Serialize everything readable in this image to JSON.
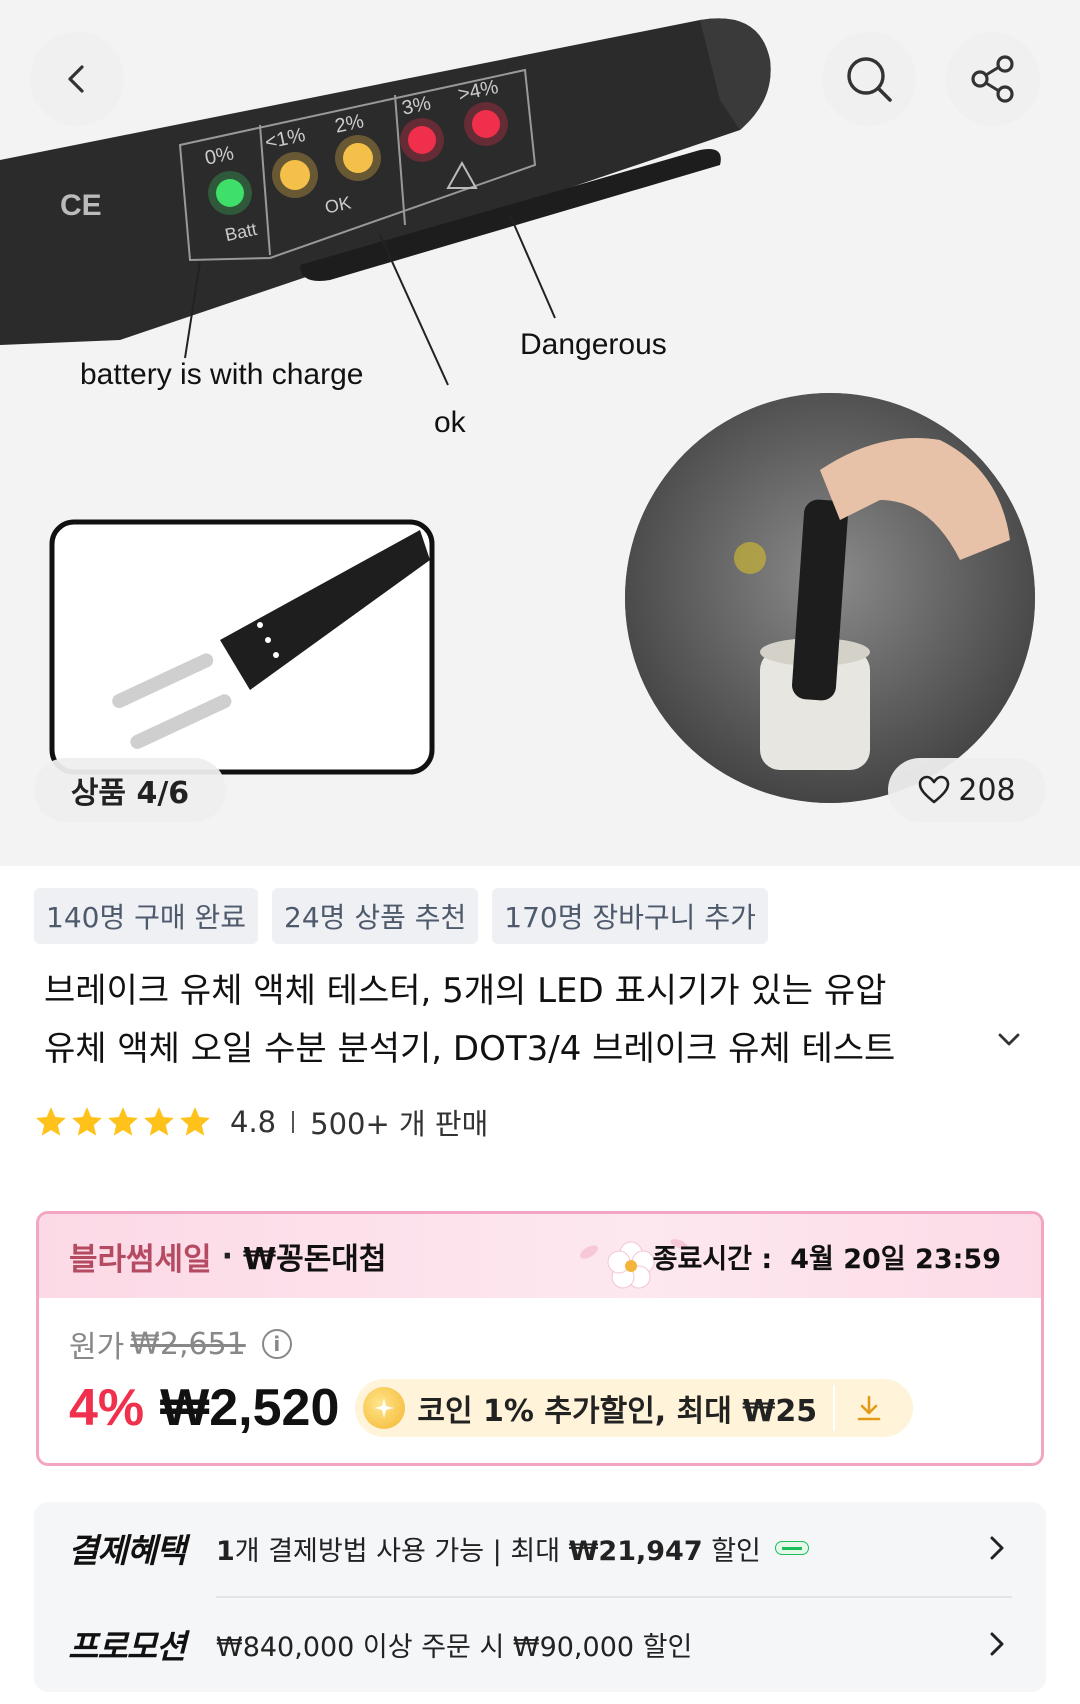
{
  "hero": {
    "counter": "상품 4/6",
    "likes": "208",
    "image_text": {
      "battery_label": "battery is with charge",
      "dangerous_label": "Dangerous",
      "ok_label": "ok",
      "led_0": "0%",
      "led_1": "<1%",
      "led_2": "2%",
      "led_3": "3%",
      "led_4": ">4%",
      "batt": "Batt",
      "ok_small": "OK"
    }
  },
  "tags": [
    "140명 구매 완료",
    "24명 상품 추천",
    "170명 장바구니 추가"
  ],
  "title": {
    "line1": "브레이크 유체 액체 테스터, 5개의 LED 표시기가 있는 유압",
    "line2": "유체 액체 오일 수분 분석기, DOT3/4 브레이크 유체 테스트"
  },
  "rating": {
    "stars": 5,
    "score": "4.8",
    "sold": "500+ 개 판매"
  },
  "sale": {
    "name": "블라썸세일",
    "sub": "₩꽁돈대첩",
    "end_label": "종료시간 :",
    "end_time": "4월 20일 23:59",
    "orig_label": "원가",
    "orig_price": "₩2,651",
    "discount": "4%",
    "price": "₩2,520",
    "coin_text": "코인 1% 추가할인, 최대 ₩25"
  },
  "benefits": {
    "payment_label": "결제혜택",
    "payment_text_pre": "1",
    "payment_text_mid": "개 결제방법 사용 가능 | 최대 ",
    "payment_amount": "₩21,947",
    "payment_text_post": " 할인",
    "promo_label": "프로모션",
    "promo_text": "₩840,000 이상 주문 시 ₩90,000 할인"
  },
  "colors": {
    "discount_red": "#f0304c",
    "sale_pink_border": "#f3a6c3",
    "sale_name": "#b44b62",
    "tag_bg": "#eef0f4",
    "star": "#ffc21a"
  }
}
